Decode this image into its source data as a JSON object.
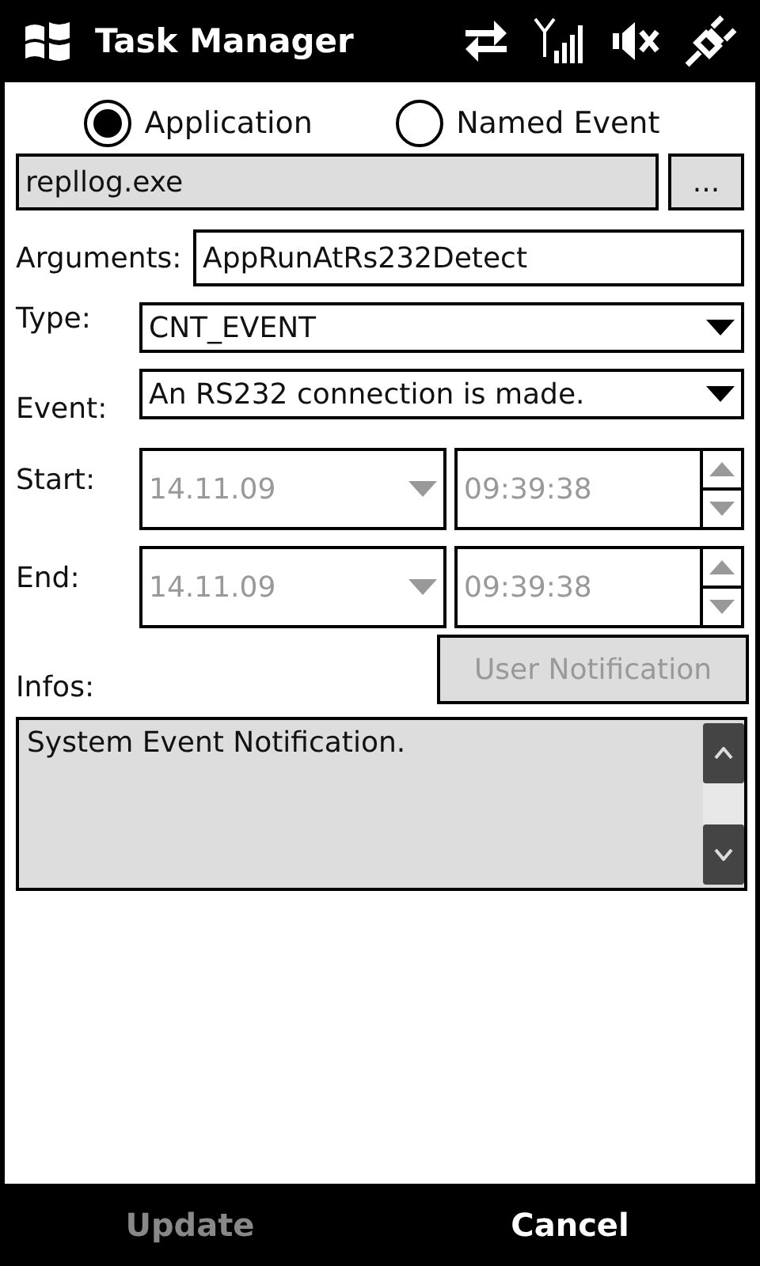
{
  "title_bar": {
    "title": "Task Manager"
  },
  "mode": [
    {
      "label": "Application",
      "selected": true
    },
    {
      "label": "Named Event",
      "selected": false
    }
  ],
  "program": {
    "value": "repllog.exe",
    "browse": "..."
  },
  "arguments": {
    "label": "Arguments:",
    "value": "AppRunAtRs232Detect"
  },
  "type": {
    "label": "Type:",
    "value": "CNT_EVENT"
  },
  "event": {
    "label": "Event:",
    "value": "An RS232 connection is made."
  },
  "times": [
    {
      "label": "Start:",
      "date": "14.11.09",
      "time": "09:39:38",
      "disabled": true
    },
    {
      "label": "End:",
      "date": "14.11.09",
      "time": "09:39:38",
      "disabled": true
    }
  ],
  "user_notification": {
    "label": "User Notification",
    "disabled": true
  },
  "infos": {
    "label": "Infos:",
    "value": "System Event Notification."
  },
  "softkeys": [
    {
      "label": "Update",
      "disabled": true
    },
    {
      "label": "Cancel",
      "disabled": false
    }
  ]
}
